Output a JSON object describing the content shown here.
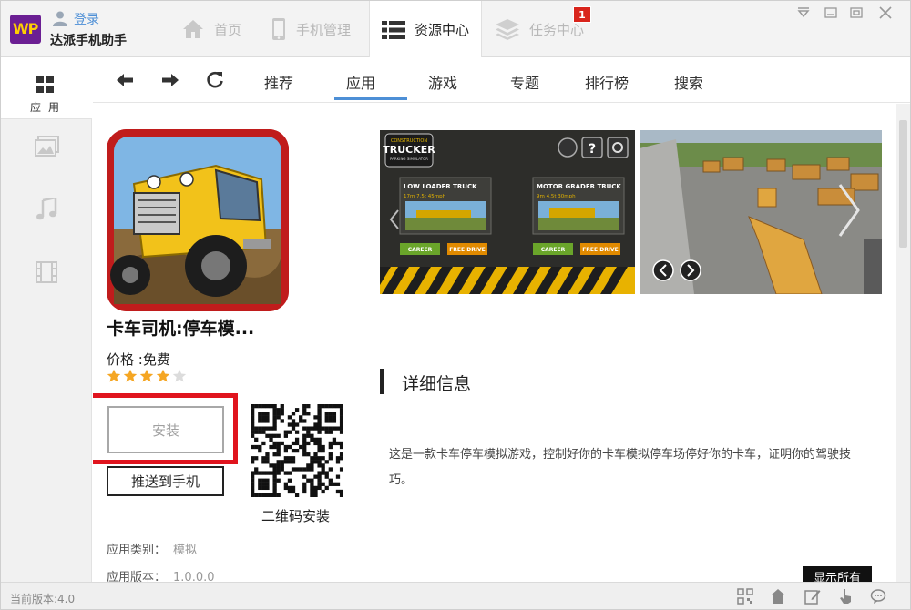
{
  "header": {
    "logo_text": "WP",
    "login_label": "登录",
    "app_name": "达派手机助手",
    "tabs": [
      {
        "label": "首页",
        "icon": "home-icon"
      },
      {
        "label": "手机管理",
        "icon": "phone-icon"
      },
      {
        "label": "资源中心",
        "icon": "list-icon",
        "active": true
      },
      {
        "label": "任务中心",
        "icon": "layers-icon"
      }
    ],
    "task_badge": "1"
  },
  "sidebar": {
    "apps_label": "应用",
    "items": [
      {
        "icon": "apps-grid-icon",
        "active": true
      },
      {
        "icon": "image-icon"
      },
      {
        "icon": "music-icon"
      },
      {
        "icon": "video-icon"
      }
    ]
  },
  "nav": {
    "tabs": [
      "推荐",
      "应用",
      "游戏",
      "专题",
      "排行榜",
      "搜索"
    ],
    "active_tab": "推荐"
  },
  "app": {
    "title": "卡车司机:停车模...",
    "price": "价格 :免费",
    "rating": 4,
    "rating_max": 5,
    "install_label": "安装",
    "push_label": "推送到手机",
    "qr_label": "二维码安装",
    "category_label": "应用类别：",
    "category_value": "模拟",
    "version_label": "应用版本：",
    "version_value": "1.0.0.0"
  },
  "screenshots": {
    "shot1": {
      "logo_small": "CONSTRUCTION",
      "logo_big": "TRUCKER",
      "logo_sub": "PARKING SIMULATOR",
      "truck1_name": "LOW LOADER TRUCK",
      "truck1_stats": "17m  7.5t  45mph",
      "truck2_name": "MOTOR GRADER TRUCK",
      "truck2_stats": "9m  4.5t  30mph",
      "career_label": "CAREER",
      "free_drive_label": "FREE DRIVE"
    }
  },
  "details": {
    "heading": "详细信息",
    "description": "这是一款卡车停车模拟游戏，控制好你的卡车模拟停车场停好你的卡车，证明你的驾驶技巧。",
    "show_all_label": "显示所有"
  },
  "status": {
    "version_text": "当前版本:4.0"
  },
  "colors": {
    "accent": "#4d8fd6",
    "highlight_red": "#e0141e",
    "badge_red": "#d9251c",
    "logo_purple": "#6b1f93"
  }
}
